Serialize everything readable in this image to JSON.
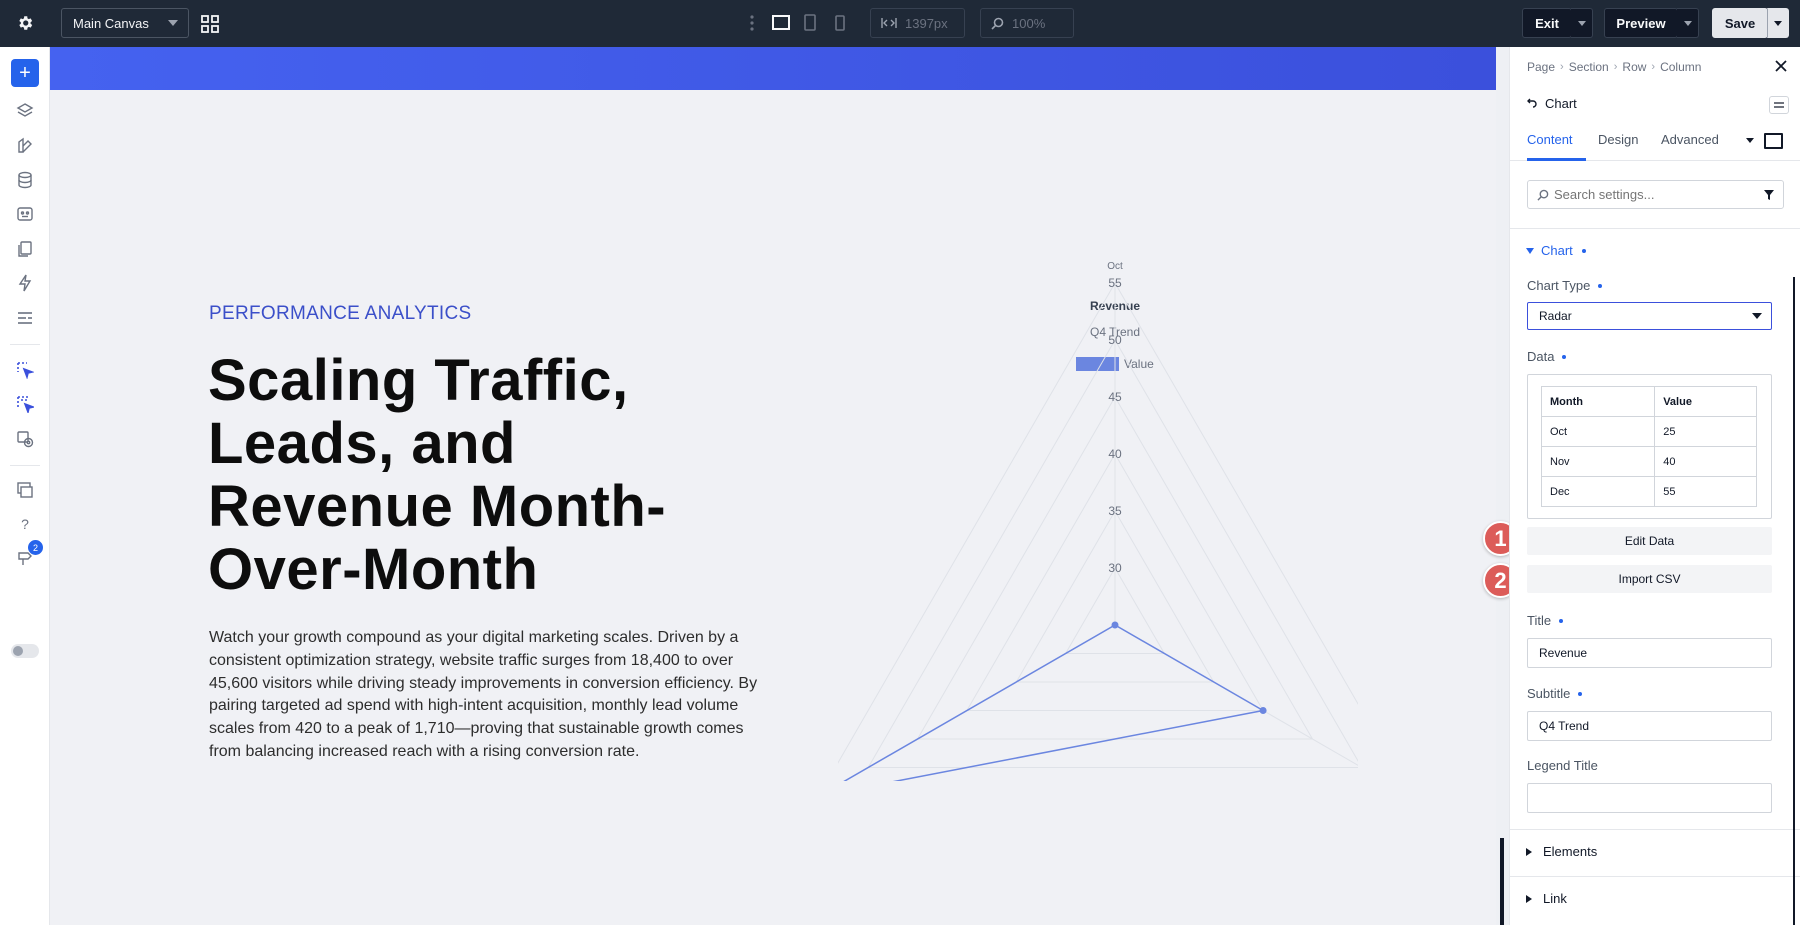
{
  "topbar": {
    "canvas_select": "Main Canvas",
    "width_value": "1397px",
    "zoom_value": "100%",
    "exit_label": "Exit",
    "preview_label": "Preview",
    "save_label": "Save"
  },
  "leftrail": {
    "notification_count": "2"
  },
  "canvas": {
    "eyebrow": "PERFORMANCE ANALYTICS",
    "headline": "Scaling Traffic, Leads, and Revenue Month-Over-Month",
    "body": "Watch your growth compound as your digital marketing scales. Driven by a consistent optimization strategy, website traffic surges from 18,400 to over 45,600 visitors while driving steady improvements in conversion efficiency. By pairing targeted ad spend with high-intent acquisition, monthly lead volume scales from 420 to a peak of 1,710—proving that sustainable growth comes from balancing increased reach with a rising conversion rate."
  },
  "chart_data": {
    "type": "radar",
    "title": "Revenue",
    "subtitle": "Q4 Trend",
    "categories": [
      "Oct",
      "Nov",
      "Dec"
    ],
    "series": [
      {
        "name": "Value",
        "values": [
          25,
          40,
          55
        ],
        "color": "#6b86e0"
      }
    ],
    "radial_ticks": [
      "30",
      "35",
      "40",
      "45",
      "50",
      "55"
    ],
    "range": [
      25,
      55
    ],
    "legend_position": "top",
    "grid": true
  },
  "panel": {
    "breadcrumbs": [
      "Page",
      "Section",
      "Row",
      "Column"
    ],
    "module_title": "Chart",
    "tabs": [
      "Content",
      "Design",
      "Advanced"
    ],
    "search_placeholder": "Search settings...",
    "section_chart": "Chart",
    "chart_type_label": "Chart Type",
    "chart_type_value": "Radar",
    "data_label": "Data",
    "table": {
      "headers": [
        "Month",
        "Value"
      ],
      "rows": [
        [
          "Oct",
          "25"
        ],
        [
          "Nov",
          "40"
        ],
        [
          "Dec",
          "55"
        ]
      ]
    },
    "edit_data_label": "Edit Data",
    "import_csv_label": "Import CSV",
    "title_label": "Title",
    "title_value": "Revenue",
    "subtitle_label": "Subtitle",
    "subtitle_value": "Q4 Trend",
    "legend_title_label": "Legend Title",
    "legend_title_value": "",
    "elements_label": "Elements",
    "link_label": "Link"
  },
  "steps": [
    "1",
    "2"
  ],
  "colors": {
    "accent": "#2563eb",
    "hero_band": "#4562f0",
    "step_badge": "#dc5c59",
    "topbar": "#1f2937"
  }
}
